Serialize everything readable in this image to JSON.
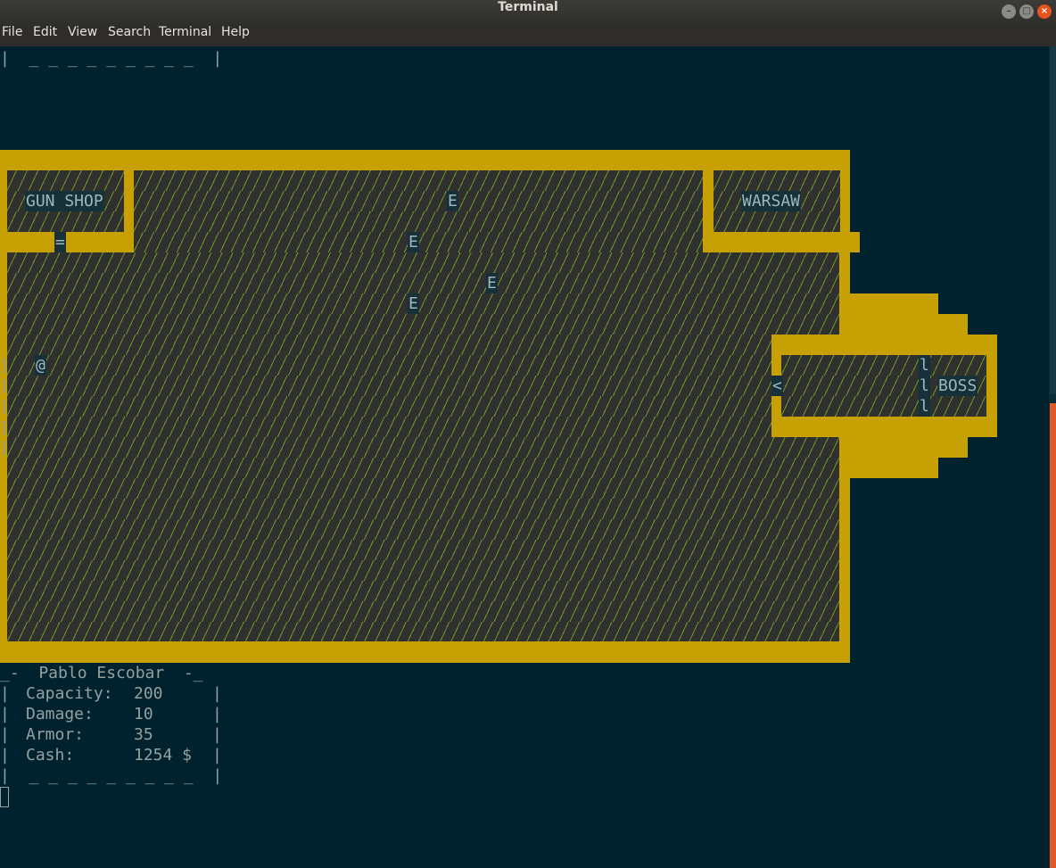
{
  "window": {
    "title": "Terminal"
  },
  "menu": [
    "File",
    "Edit",
    "View",
    "Search",
    "Terminal",
    "Help"
  ],
  "top_fragment": "|  _ _ _ _ _ _ _ _ _  |",
  "map": {
    "gun_shop": "GUN SHOP",
    "warsaw": "WARSAW",
    "boss": "BOSS",
    "door_glyph": "=",
    "player_glyph": "@",
    "enemy_glyph": "E",
    "exit_glyph": "<",
    "gate_glyph": "l",
    "edge_glyph": "]"
  },
  "stats": {
    "header": "_-  Pablo Escobar  -_",
    "rows": [
      {
        "label": "Capacity:",
        "value": "200"
      },
      {
        "label": "Damage:",
        "value": "10"
      },
      {
        "label": "Armor:",
        "value": "35"
      },
      {
        "label": "Cash:",
        "value": "1254 $"
      }
    ],
    "footer": "|  _ _ _ _ _ _ _ _ _  |"
  }
}
